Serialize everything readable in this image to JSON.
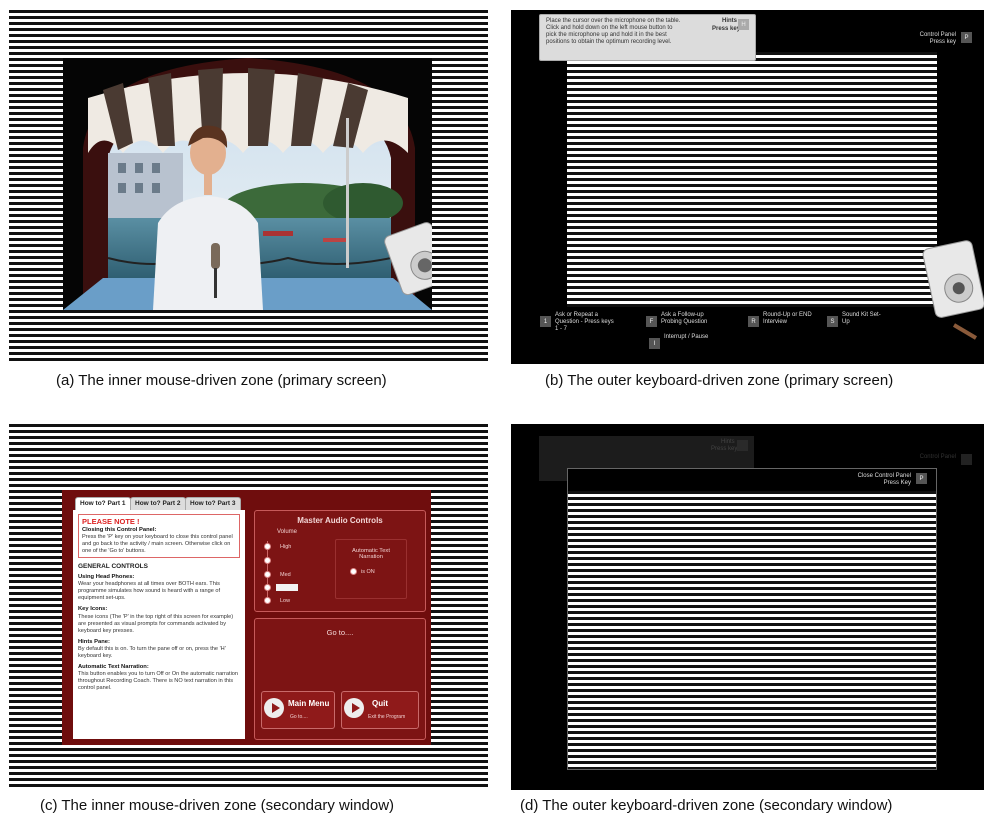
{
  "figure": {
    "panels": [
      {
        "id": "a",
        "caption": "(a) The inner mouse-driven zone (primary screen)"
      },
      {
        "id": "b",
        "caption": "(b) The outer keyboard-driven zone  (primary screen)"
      },
      {
        "id": "c",
        "caption": "(c) The inner mouse-driven zone (secondary window)"
      },
      {
        "id": "d",
        "caption": "(d) The outer keyboard-driven zone  (secondary window)"
      }
    ]
  },
  "panel_b": {
    "hint_text": "Place the cursor over the microphone on the table. Click and hold down on the left mouse button to pick the microphone up and hold it in the best positions to obtain the optimum recording level.",
    "hints_title": "Hints",
    "hints_key_label": "Press key",
    "hints_key": "H",
    "control_panel_title": "Control Panel",
    "control_panel_key_label": "Press key",
    "control_panel_key": "P",
    "bottom_items": [
      {
        "key": "1",
        "label": "Ask or Repeat a Question - Press keys 1 - 7"
      },
      {
        "key": "F",
        "label": "Ask a Follow-up Probing Question"
      },
      {
        "key": "R",
        "label": "Round-Up or END Interview"
      },
      {
        "key": "S",
        "label": "Sound Kit Set-Up"
      },
      {
        "key": "I",
        "label": "Interrupt / Pause"
      }
    ]
  },
  "panel_c": {
    "tabs": [
      "How to? Part 1",
      "How to? Part 2",
      "How to? Part 3"
    ],
    "note_title": "PLEASE NOTE !",
    "note_subtitle": "Closing this Control Panel:",
    "note_text": "Press the 'P' key on your keyboard to close this control panel and go back to the activity / main screen. Otherwise click on one of the 'Go to' buttons.",
    "section_title": "GENERAL CONTROLS",
    "sections": [
      {
        "title": "Using Head Phones:",
        "text": "Wear your headphones at all times over BOTH ears. This programme simulates how sound is heard with a range of equipment set-ups."
      },
      {
        "title": "Key Icons:",
        "text": "These icons (The 'P' in the top right of this screen for example) are presented as visual prompts for commands activated by keyboard key presses."
      },
      {
        "title": "Hints Pane:",
        "text": "By default this is on. To turn the pane off or on, press the 'H' keyboard key."
      },
      {
        "title": "Automatic Text Narration:",
        "text": "This button enables you to turn Off or On the automatic narration throughout Recording Coach. There is NO text narration in this control panel."
      }
    ],
    "audio_title": "Master Audio Controls",
    "volume_label": "Volume",
    "volume_levels": [
      "High",
      "Med",
      "Low"
    ],
    "narration_title": "Automatic Text Narration",
    "narration_state": "is ON",
    "goto_title": "Go to....",
    "main_menu_label": "Main Menu",
    "main_menu_sub": "Go to....",
    "quit_label": "Quit",
    "quit_sub": "Exit the Program"
  },
  "panel_d": {
    "hints_title": "Hints",
    "hints_key_label": "Press key",
    "control_panel_title": "Control Panel",
    "close_title": "Close Control Panel",
    "close_key_label": "Press Key",
    "close_key": "P"
  },
  "colors": {
    "dark_red": "#6f0d0d",
    "panel_red": "#8f1a1a",
    "black": "#000000"
  }
}
